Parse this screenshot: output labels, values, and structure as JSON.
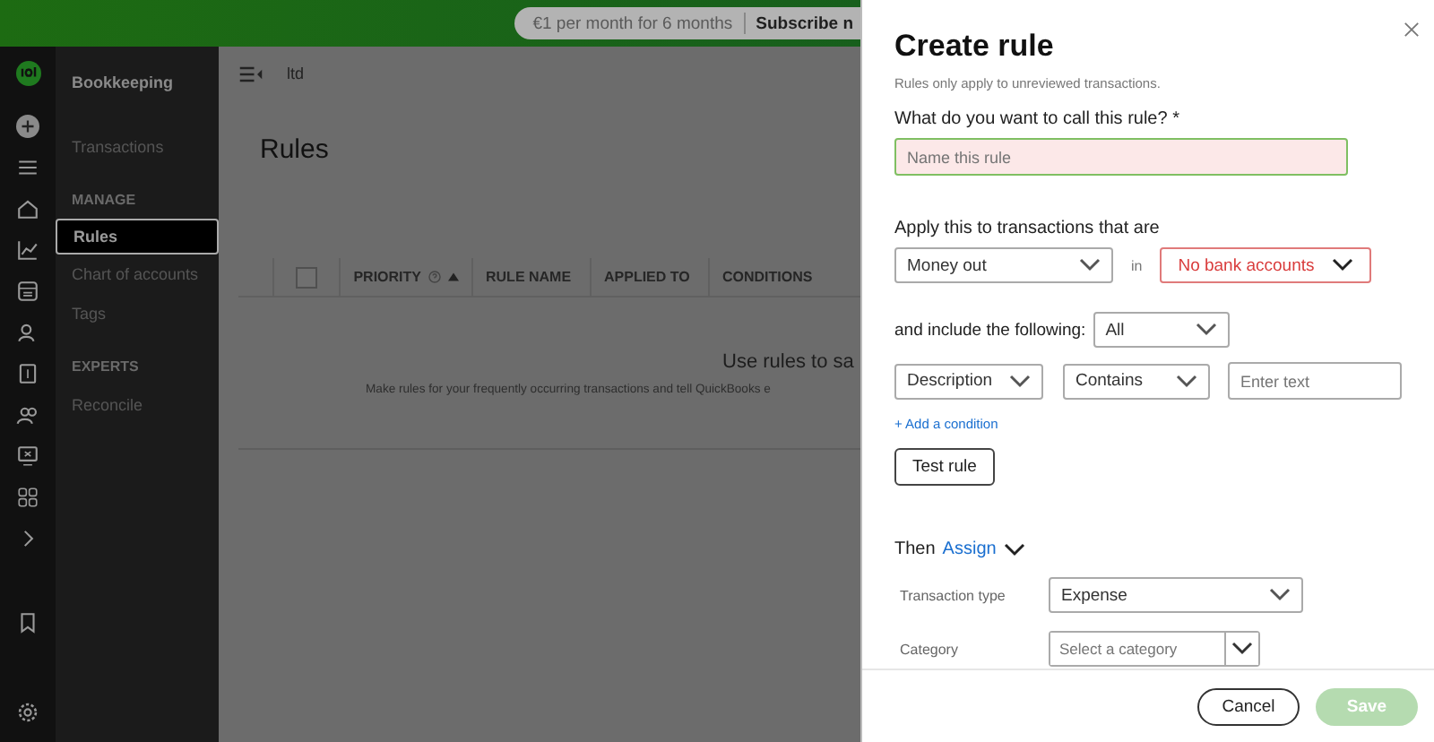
{
  "banner": {
    "offer": "€1 per month for 6 months",
    "cta": "Subscribe n"
  },
  "nav": {
    "title": "Bookkeeping",
    "top_items": [
      {
        "label": "Transactions",
        "selected": false
      }
    ],
    "sections": [
      {
        "heading": "MANAGE",
        "items": [
          {
            "label": "Rules",
            "selected": true
          },
          {
            "label": "Chart of accounts",
            "selected": false
          },
          {
            "label": "Tags",
            "selected": false
          }
        ]
      },
      {
        "heading": "EXPERTS",
        "items": [
          {
            "label": "Reconcile",
            "selected": false
          }
        ]
      }
    ]
  },
  "main": {
    "company": "ltd",
    "title": "Rules",
    "table": {
      "select_all_checked": false,
      "columns": [
        {
          "label": "PRIORITY",
          "help": true,
          "sorted": true
        },
        {
          "label": "RULE NAME",
          "help": false,
          "sorted": false
        },
        {
          "label": "APPLIED TO",
          "help": false,
          "sorted": false
        },
        {
          "label": "CONDITIONS",
          "help": false,
          "sorted": false
        }
      ],
      "empty_title": "Use rules to sa",
      "empty_text": "Make rules for your frequently occurring transactions and tell QuickBooks e"
    }
  },
  "dialog": {
    "title": "Create rule",
    "subtitle": "Rules only apply to unreviewed transactions.",
    "name_field": {
      "label": "What do you want to call this rule? *",
      "placeholder": "Name this rule",
      "invalid": true,
      "focused": true
    },
    "apply": {
      "label": "Apply this to transactions that are",
      "direction": "Money out",
      "in_label": "in",
      "accounts": {
        "value": "No bank accounts",
        "error": true
      }
    },
    "include": {
      "label": "and include the following:",
      "value": "All"
    },
    "conditions": [
      {
        "field": "Description",
        "operator": "Contains",
        "placeholder": "Enter text"
      }
    ],
    "add_condition": "+ Add a condition",
    "test_button": "Test rule",
    "then": {
      "label": "Then",
      "action": "Assign"
    },
    "assign_fields": [
      {
        "label": "Transaction type",
        "kind": "select",
        "value": "Expense"
      },
      {
        "label": "Category",
        "kind": "combo",
        "placeholder": "Select a category"
      }
    ],
    "cancel": "Cancel",
    "save": {
      "label": "Save",
      "disabled": true
    }
  }
}
